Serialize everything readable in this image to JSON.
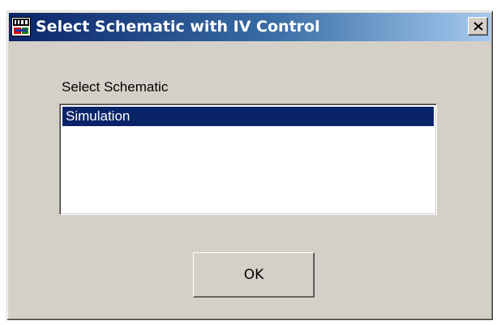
{
  "window": {
    "title": "Select Schematic with IV Control",
    "icon": "app-window-icon",
    "close_icon": "close-icon"
  },
  "form": {
    "label": "Select Schematic",
    "items": [
      {
        "label": "Simulation",
        "selected": true
      }
    ],
    "ok_label": "OK"
  },
  "colors": {
    "selection": "#0a246a",
    "titlebar_start": "#0a246a",
    "titlebar_end": "#a6caf0",
    "face": "#d4d0c8"
  }
}
